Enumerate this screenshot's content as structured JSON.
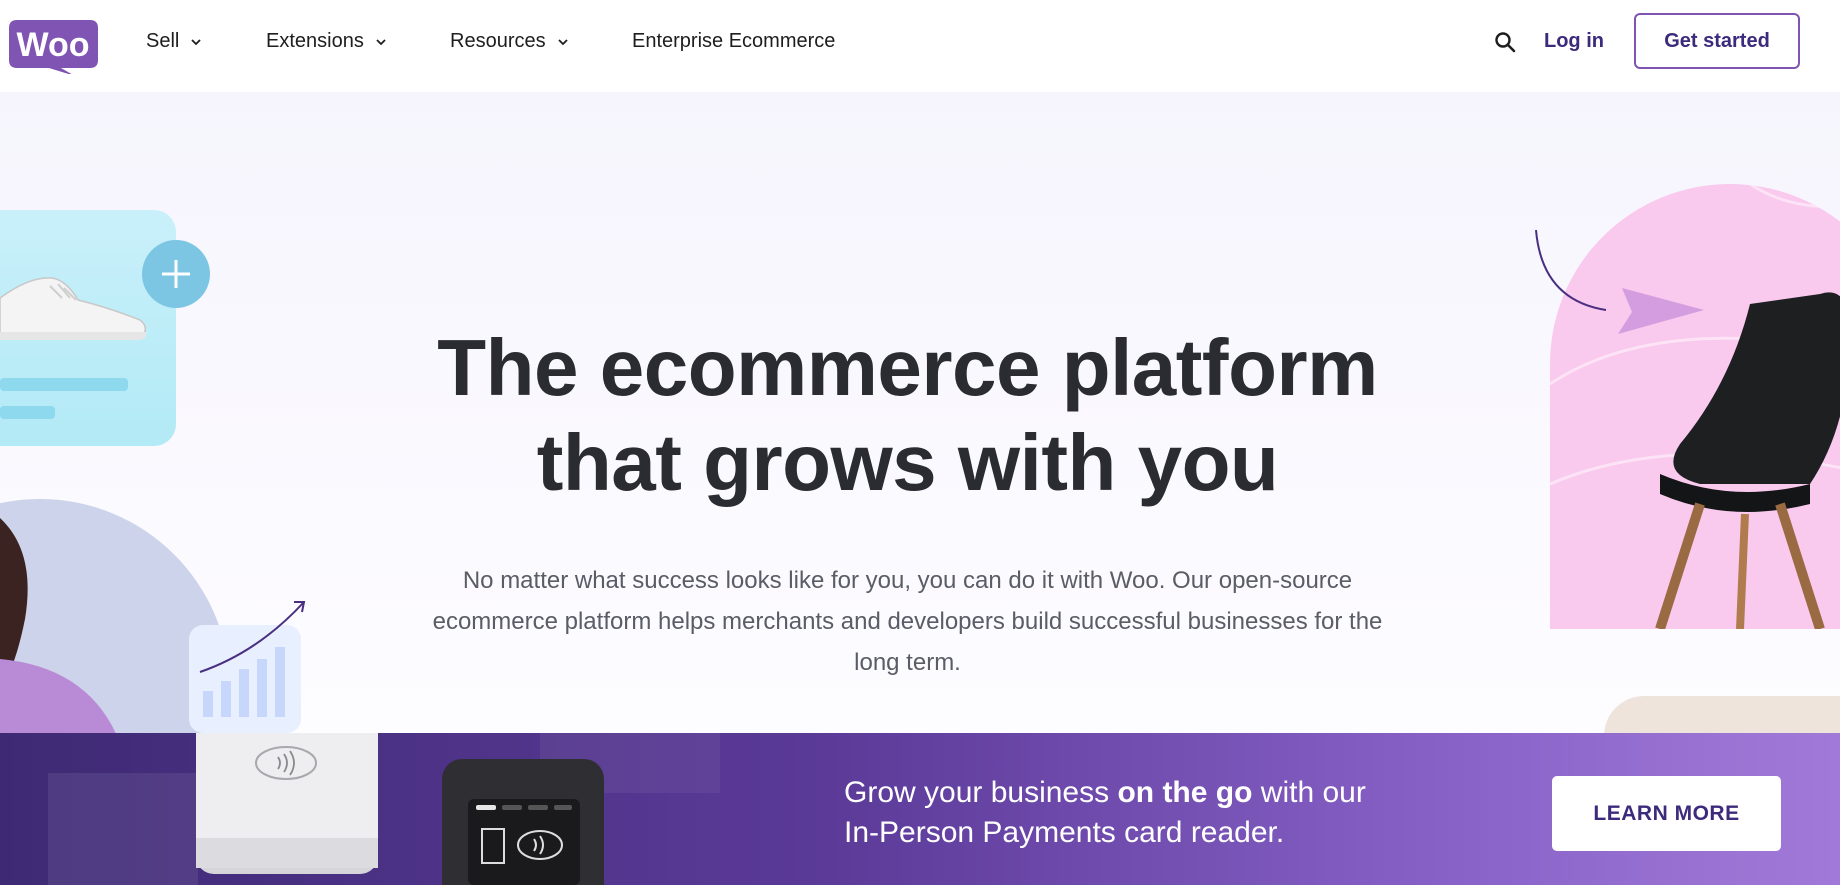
{
  "brand": {
    "logo_text": "Woo",
    "accent_color": "#7f54b3",
    "dark_accent": "#3c2a7c"
  },
  "nav": {
    "items": [
      {
        "label": "Sell",
        "has_dropdown": true
      },
      {
        "label": "Extensions",
        "has_dropdown": true
      },
      {
        "label": "Resources",
        "has_dropdown": true
      },
      {
        "label": "Enterprise Ecommerce",
        "has_dropdown": false
      }
    ],
    "search_icon": "search-icon",
    "login_label": "Log in",
    "cta_label": "Get started"
  },
  "hero": {
    "title_line1": "The ecommerce platform",
    "title_line2": "that grows with you",
    "subtitle": "No matter what success looks like for you, you can do it with Woo. Our open-source ecommerce platform helps merchants and developers build successful businesses for the long term."
  },
  "promo": {
    "text_before": "Grow your business ",
    "text_bold": "on the go",
    "text_after": " with our",
    "text_line2": "In-Person Payments card reader.",
    "button_label": "LEARN MORE"
  }
}
